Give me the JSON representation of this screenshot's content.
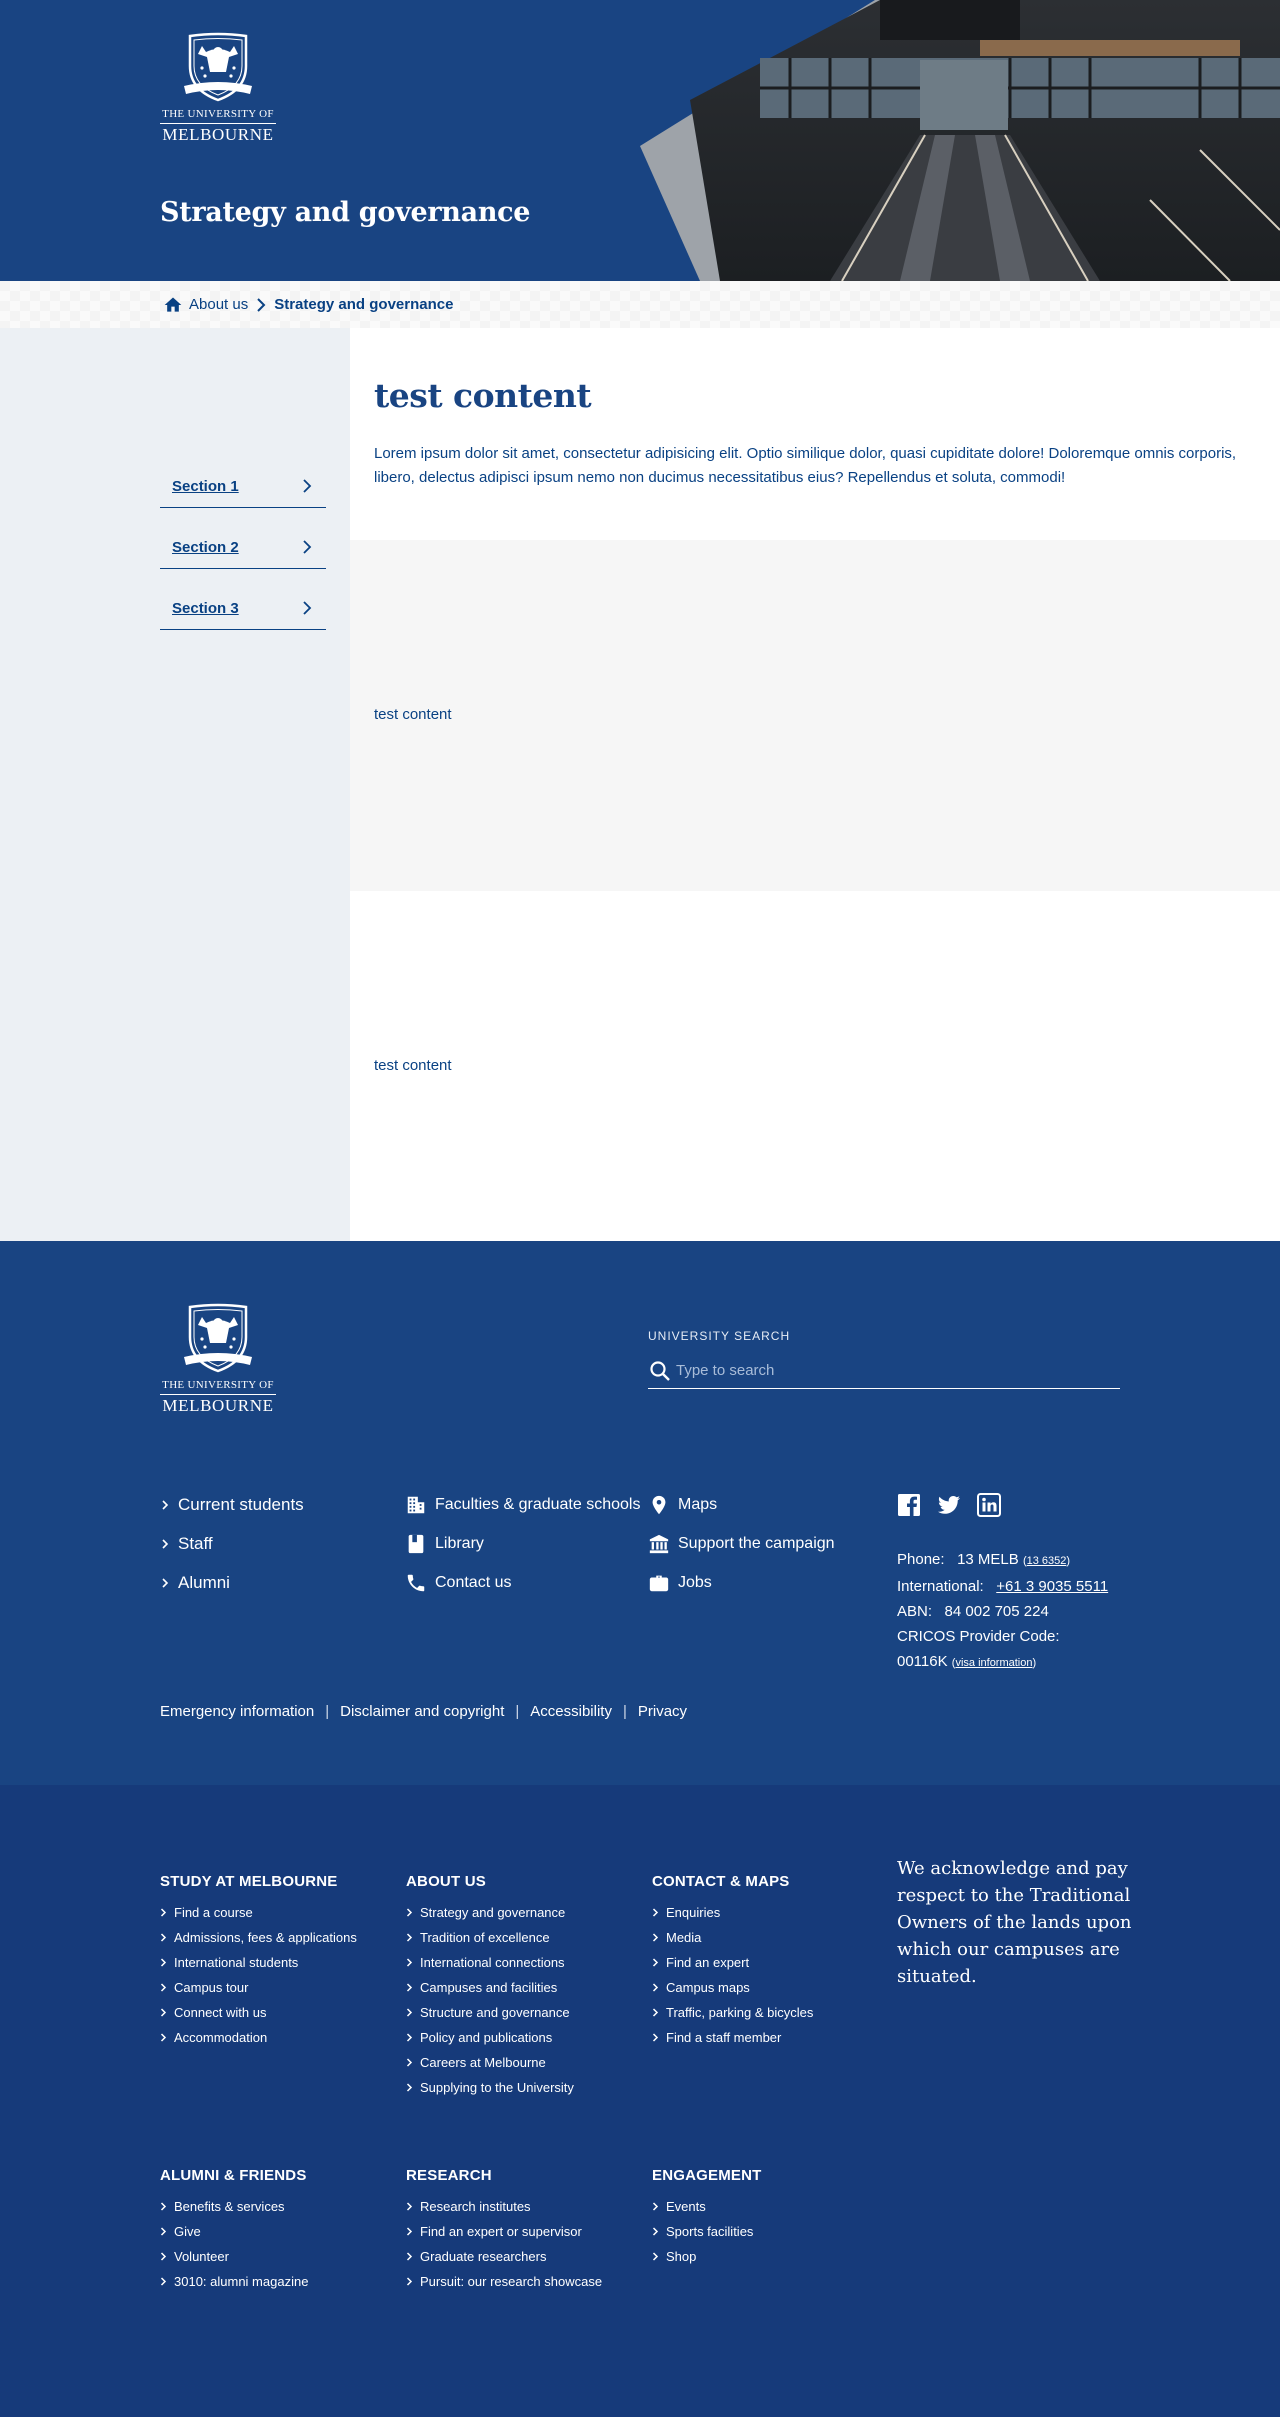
{
  "header": {
    "logo_line1": "The University of",
    "logo_line2": "MELBOURNE",
    "title": "Strategy and governance"
  },
  "breadcrumb": {
    "home_label": "About us",
    "current": "Strategy and governance"
  },
  "sidebar": {
    "items": [
      {
        "label": "Section 1"
      },
      {
        "label": "Section 2"
      },
      {
        "label": "Section 3"
      }
    ]
  },
  "main": {
    "heading": "test content",
    "body": "Lorem ipsum dolor sit amet, consectetur adipisicing elit. Optio similique dolor, quasi cupiditate dolore! Doloremque omnis corporis, libero, delectus adipisci ipsum nemo non ducimus necessitatibus eius? Repellendus et soluta, commodi!",
    "block2_text": "test content",
    "block3_text": "test content"
  },
  "footer": {
    "logo_line1": "The University of",
    "logo_line2": "MELBOURNE",
    "search_label": "University search",
    "search_placeholder": "Type to search",
    "audience_links": [
      "Current students",
      "Staff",
      "Alumni"
    ],
    "links_col2": [
      {
        "label": "Faculties & graduate schools",
        "icon": "building-icon"
      },
      {
        "label": "Library",
        "icon": "book-icon"
      },
      {
        "label": "Contact us",
        "icon": "phone-icon"
      }
    ],
    "links_col3": [
      {
        "label": "Maps",
        "icon": "map-pin-icon"
      },
      {
        "label": "Support the campaign",
        "icon": "institution-icon"
      },
      {
        "label": "Jobs",
        "icon": "briefcase-icon"
      }
    ],
    "social": [
      "facebook-icon",
      "twitter-icon",
      "linkedin-icon"
    ],
    "contact": {
      "phone_label": "Phone:",
      "phone_value": "13 MELB",
      "phone_alt": "13 6352",
      "intl_label": "International:",
      "intl_value": "+61 3 9035 5511",
      "abn_label": "ABN:",
      "abn_value": "84 002 705 224",
      "cricos_label": "CRICOS Provider Code:",
      "cricos_value": "00116K",
      "visa_link": "visa information"
    },
    "legal": [
      "Emergency information",
      "Disclaimer and copyright",
      "Accessibility",
      "Privacy"
    ]
  },
  "sitemap": {
    "columns": [
      {
        "heading": "Study at Melbourne",
        "items": [
          "Find a course",
          "Admissions, fees & applications",
          "International students",
          "Campus tour",
          "Connect with us",
          "Accommodation"
        ]
      },
      {
        "heading": "About Us",
        "items": [
          "Strategy and governance",
          "Tradition of excellence",
          "International connections",
          "Campuses and facilities",
          "Structure and governance",
          "Policy and publications",
          "Careers at Melbourne",
          "Supplying to the University"
        ]
      },
      {
        "heading": "Contact & Maps",
        "items": [
          "Enquiries",
          "Media",
          "Find an expert",
          "Campus maps",
          "Traffic, parking & bicycles",
          "Find a staff member"
        ]
      },
      {
        "heading": "Alumni & Friends",
        "items": [
          "Benefits & services",
          "Give",
          "Volunteer",
          "3010: alumni magazine"
        ]
      },
      {
        "heading": "Research",
        "items": [
          "Research institutes",
          "Find an expert or supervisor",
          "Graduate researchers",
          "Pursuit: our research showcase"
        ]
      },
      {
        "heading": "Engagement",
        "items": [
          "Events",
          "Sports facilities",
          "Shop"
        ]
      }
    ],
    "acknowledgement": "We acknowledge and pay respect to the Traditional Owners of the lands upon which our campuses are situated."
  },
  "colors": {
    "brand_navy": "#194482",
    "text_navy": "#094183",
    "footer_dark": "#163a7a",
    "sidebar_bg": "#ecf0f4"
  }
}
